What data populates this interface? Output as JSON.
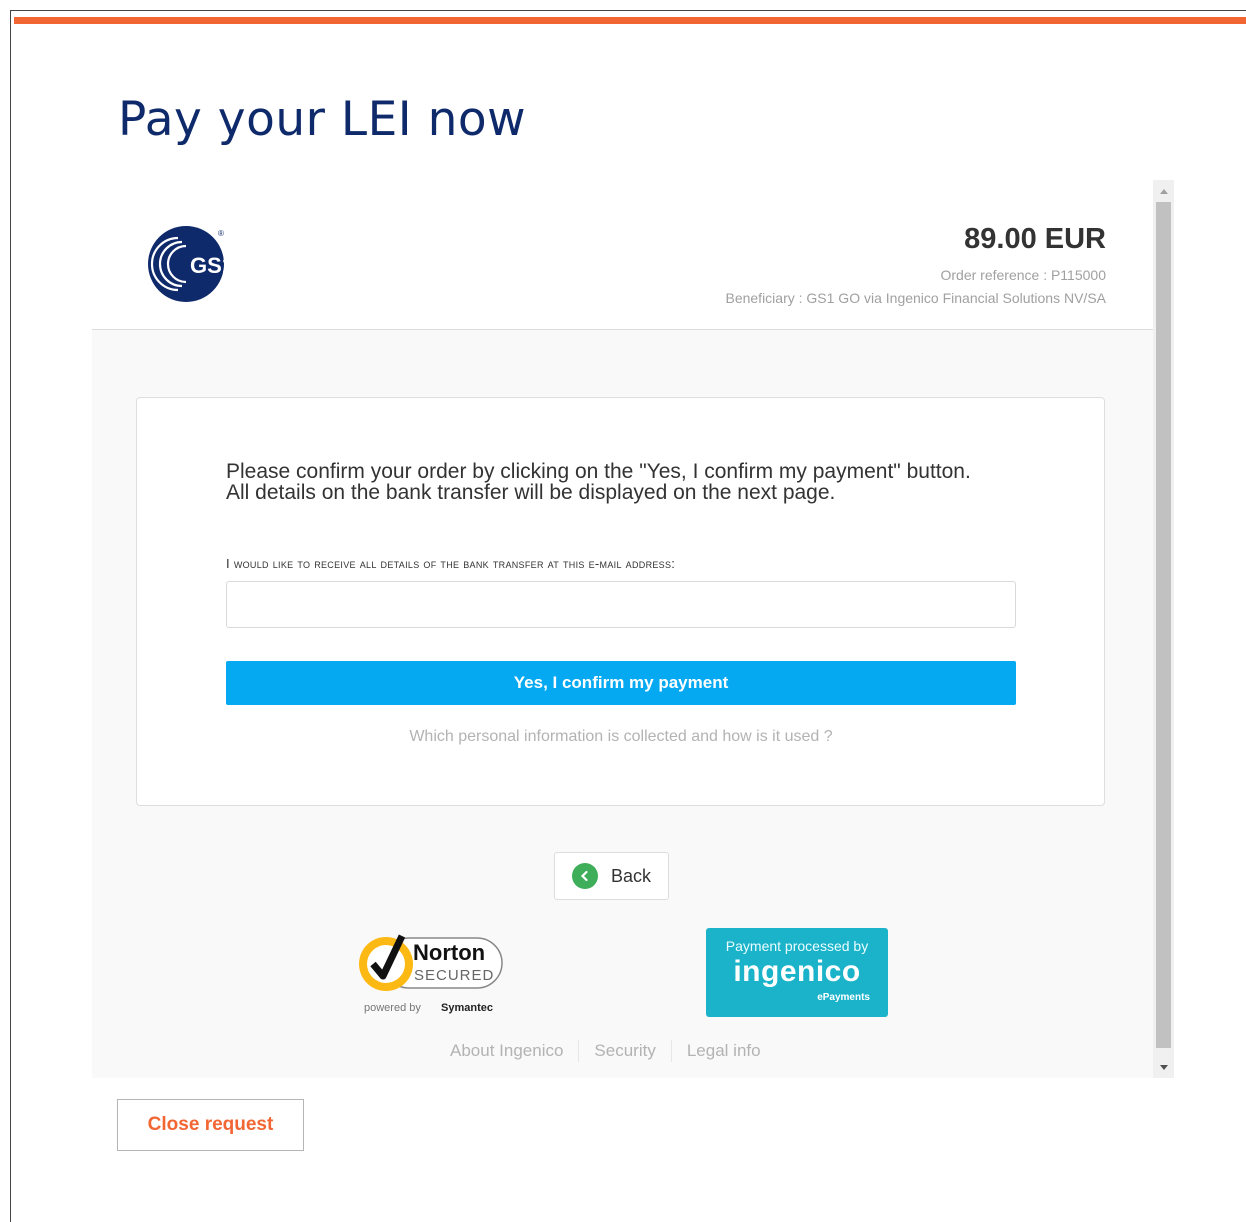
{
  "page": {
    "title": "Pay your LEI now"
  },
  "payment": {
    "logo_text": "GS1",
    "amount": "89.00 EUR",
    "order_reference": "Order reference : P115000",
    "beneficiary": "Beneficiary : GS1 GO via Ingenico Financial Solutions NV/SA",
    "instruction_line1": "Please confirm your order by clicking on the \"Yes, I confirm my payment\" button.",
    "instruction_line2": "All details on the bank transfer will be displayed on the next page.",
    "email_label": "I would like to receive all details of the bank transfer at this e-mail address:",
    "email_value": "",
    "confirm_label": "Yes, I confirm my payment",
    "privacy_link": "Which personal information is collected and how is it used ?",
    "back_label": "Back"
  },
  "badges": {
    "norton_name": "Norton",
    "norton_secured": "SECURED",
    "norton_powered": "powered by",
    "norton_symantec": "Symantec",
    "ingenico_caption": "Payment processed by",
    "ingenico_name": "ingenico",
    "ingenico_sub": "ePayments"
  },
  "footer": {
    "links": [
      "About Ingenico",
      "Security",
      "Legal info"
    ]
  },
  "actions": {
    "close_label": "Close request"
  },
  "colors": {
    "accent_orange": "#f26634",
    "title_navy": "#0f2a6b",
    "confirm_blue": "#04a9f2",
    "back_green": "#3fae5a",
    "ingenico_teal": "#1bb3c9"
  },
  "icons": [
    "gs1-logo",
    "back-chevron-icon",
    "norton-check-icon",
    "scroll-up-arrow-icon",
    "scroll-down-arrow-icon"
  ]
}
